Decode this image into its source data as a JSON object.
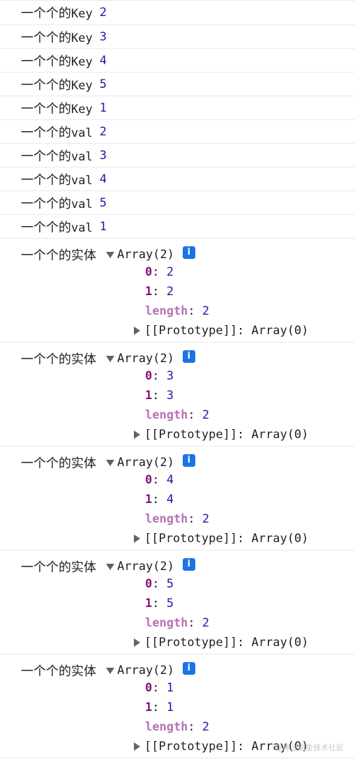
{
  "simple_logs": [
    {
      "label_cjk": "一个个的",
      "label_latin": "Key",
      "value": "2"
    },
    {
      "label_cjk": "一个个的",
      "label_latin": "Key",
      "value": "3"
    },
    {
      "label_cjk": "一个个的",
      "label_latin": "Key",
      "value": "4"
    },
    {
      "label_cjk": "一个个的",
      "label_latin": "Key",
      "value": "5"
    },
    {
      "label_cjk": "一个个的",
      "label_latin": "Key",
      "value": "1"
    },
    {
      "label_cjk": "一个个的",
      "label_latin": "val",
      "value": "2"
    },
    {
      "label_cjk": "一个个的",
      "label_latin": "val",
      "value": "3"
    },
    {
      "label_cjk": "一个个的",
      "label_latin": "val",
      "value": "4"
    },
    {
      "label_cjk": "一个个的",
      "label_latin": "val",
      "value": "5"
    },
    {
      "label_cjk": "一个个的",
      "label_latin": "val",
      "value": "1"
    }
  ],
  "array_logs": [
    {
      "label": "一个个的实体",
      "type": "Array(2)",
      "info": "i",
      "items": [
        {
          "key": "0",
          "value": "2"
        },
        {
          "key": "1",
          "value": "2"
        }
      ],
      "length_key": "length",
      "length_value": "2",
      "proto_text": "[[Prototype]]: Array(0)"
    },
    {
      "label": "一个个的实体",
      "type": "Array(2)",
      "info": "i",
      "items": [
        {
          "key": "0",
          "value": "3"
        },
        {
          "key": "1",
          "value": "3"
        }
      ],
      "length_key": "length",
      "length_value": "2",
      "proto_text": "[[Prototype]]: Array(0)"
    },
    {
      "label": "一个个的实体",
      "type": "Array(2)",
      "info": "i",
      "items": [
        {
          "key": "0",
          "value": "4"
        },
        {
          "key": "1",
          "value": "4"
        }
      ],
      "length_key": "length",
      "length_value": "2",
      "proto_text": "[[Prototype]]: Array(0)"
    },
    {
      "label": "一个个的实体",
      "type": "Array(2)",
      "info": "i",
      "items": [
        {
          "key": "0",
          "value": "5"
        },
        {
          "key": "1",
          "value": "5"
        }
      ],
      "length_key": "length",
      "length_value": "2",
      "proto_text": "[[Prototype]]: Array(0)"
    },
    {
      "label": "一个个的实体",
      "type": "Array(2)",
      "info": "i",
      "items": [
        {
          "key": "0",
          "value": "1"
        },
        {
          "key": "1",
          "value": "1"
        }
      ],
      "length_key": "length",
      "length_value": "2",
      "proto_text": "[[Prototype]]: Array(0)"
    }
  ],
  "watermark": "@稀土掘金技术社区",
  "colors": {
    "number": "#1a1aa6",
    "index_key": "#881280",
    "length_key": "#b871b8",
    "info_badge": "#1a73e8",
    "row_divider": "#e9e9e9"
  },
  "icons": {
    "expanded": "triangle-down-icon",
    "collapsed": "triangle-right-icon",
    "info": "info-icon"
  }
}
